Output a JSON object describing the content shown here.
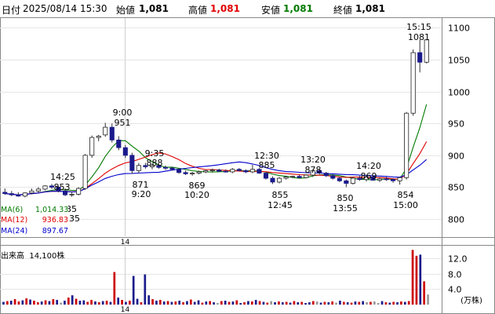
{
  "header": {
    "label_date": "日付",
    "datetime": "2025/08/14 15:30",
    "label_open": "始値",
    "open": "1,081",
    "label_high": "高値",
    "high": "1,081",
    "label_low": "安値",
    "low": "1,081",
    "label_close": "終値",
    "close": "1,081"
  },
  "ma_legend": [
    {
      "name": "MA(6)",
      "value": "1,014.33",
      "color": "#007a00"
    },
    {
      "name": "MA(12)",
      "value": "936.83",
      "color": "#e00000"
    },
    {
      "name": "MA(24)",
      "value": "897.67",
      "color": "#0000cc"
    }
  ],
  "volume_label": {
    "name": "出来高",
    "value": "14,100株"
  },
  "colors": {
    "up": "#cc0000",
    "down": "#1a1a8c",
    "flat": "#999999",
    "grid": "#e6e6e6"
  },
  "chart_data": [
    {
      "type": "candlestick",
      "title": "",
      "y_axis_side": "right",
      "y_ticks": [
        800,
        850,
        900,
        950,
        1000,
        1050,
        1100
      ],
      "ylim": [
        773,
        1114
      ],
      "x_tick_labels": [
        "14"
      ],
      "candles": [
        [
          842,
          848,
          838,
          840
        ],
        [
          840,
          844,
          836,
          838
        ],
        [
          838,
          842,
          835,
          836
        ],
        [
          836,
          842,
          834,
          841
        ],
        [
          841,
          848,
          839,
          844
        ],
        [
          844,
          850,
          841,
          847
        ],
        [
          847,
          853,
          845,
          852
        ],
        [
          852,
          855,
          847,
          850
        ],
        [
          850,
          852,
          842,
          844
        ],
        [
          844,
          848,
          836,
          838
        ],
        [
          838,
          843,
          835,
          839
        ],
        [
          839,
          850,
          837,
          848
        ],
        [
          848,
          902,
          846,
          900
        ],
        [
          900,
          931,
          896,
          928
        ],
        [
          928,
          932,
          922,
          930
        ],
        [
          932,
          951,
          929,
          944
        ],
        [
          944,
          950,
          920,
          924
        ],
        [
          924,
          930,
          908,
          912
        ],
        [
          912,
          916,
          896,
          900
        ],
        [
          900,
          904,
          871,
          876
        ],
        [
          876,
          888,
          872,
          884
        ],
        [
          884,
          888,
          879,
          882
        ],
        [
          882,
          886,
          878,
          884
        ],
        [
          884,
          886,
          879,
          881
        ],
        [
          881,
          884,
          877,
          880
        ],
        [
          880,
          882,
          876,
          878
        ],
        [
          878,
          880,
          871,
          873
        ],
        [
          873,
          876,
          869,
          871
        ],
        [
          871,
          874,
          868,
          872
        ],
        [
          872,
          876,
          870,
          874
        ],
        [
          874,
          878,
          872,
          876
        ],
        [
          876,
          879,
          873,
          877
        ],
        [
          877,
          879,
          874,
          875
        ],
        [
          875,
          878,
          873,
          874
        ],
        [
          874,
          880,
          872,
          878
        ],
        [
          878,
          880,
          875,
          876
        ],
        [
          876,
          878,
          872,
          874
        ],
        [
          874,
          885,
          872,
          878
        ],
        [
          878,
          880,
          871,
          872
        ],
        [
          872,
          874,
          862,
          864
        ],
        [
          864,
          867,
          855,
          858
        ],
        [
          858,
          866,
          856,
          864
        ],
        [
          864,
          868,
          862,
          866
        ],
        [
          866,
          868,
          864,
          867
        ],
        [
          867,
          869,
          864,
          865
        ],
        [
          865,
          870,
          864,
          869
        ],
        [
          869,
          878,
          866,
          876
        ],
        [
          876,
          878,
          870,
          872
        ],
        [
          872,
          874,
          866,
          868
        ],
        [
          868,
          870,
          862,
          864
        ],
        [
          864,
          866,
          858,
          860
        ],
        [
          860,
          862,
          850,
          856
        ],
        [
          856,
          866,
          854,
          864
        ],
        [
          864,
          868,
          860,
          862
        ],
        [
          862,
          869,
          859,
          866
        ],
        [
          866,
          868,
          860,
          861
        ],
        [
          861,
          865,
          858,
          863
        ],
        [
          863,
          866,
          860,
          862
        ],
        [
          862,
          864,
          857,
          860
        ],
        [
          860,
          866,
          854,
          865
        ],
        [
          865,
          968,
          862,
          966
        ],
        [
          966,
          1066,
          962,
          1061
        ],
        [
          1061,
          1081,
          1030,
          1046
        ],
        [
          1046,
          1081,
          1044,
          1081
        ]
      ],
      "labels": [
        {
          "text": "14:25",
          "value": 853
        },
        {
          "text": "853",
          "value": 853
        },
        {
          "text": "9:00",
          "value": 951
        },
        {
          "text": "951",
          "value": 951
        },
        {
          "text": "9:35",
          "value": 888
        },
        {
          "text": "888",
          "value": 888
        },
        {
          "text": "871",
          "value": 871
        },
        {
          "text": "9:20",
          "value": 871
        },
        {
          "text": "869",
          "value": 869
        },
        {
          "text": "10:20",
          "value": 869
        },
        {
          "text": "12:30",
          "value": 885
        },
        {
          "text": "885",
          "value": 885
        },
        {
          "text": "855",
          "value": 855
        },
        {
          "text": "12:45",
          "value": 855
        },
        {
          "text": "13:20",
          "value": 878
        },
        {
          "text": "878",
          "value": 878
        },
        {
          "text": "850",
          "value": 850
        },
        {
          "text": "13:55",
          "value": 850
        },
        {
          "text": "14:20",
          "value": 869
        },
        {
          "text": "869",
          "value": 869
        },
        {
          "text": "854",
          "value": 854
        },
        {
          "text": "15:00",
          "value": 854
        },
        {
          "text": "15:15",
          "value": 1081
        },
        {
          "text": "1081",
          "value": 1081
        },
        {
          "text": "35",
          "value": 835
        },
        {
          "text": "35",
          "value": 835
        }
      ]
    },
    {
      "type": "bar",
      "title": "出来高",
      "y_unit": "(万株)",
      "y_ticks": [
        4.0,
        8.0,
        12.0
      ],
      "ylim": [
        0,
        15
      ],
      "values": [
        0.7,
        0.9,
        1.0,
        1.4,
        0.8,
        1.1,
        1.6,
        1.3,
        1.0,
        0.6,
        0.8,
        1.1,
        0.9,
        1.4,
        1.2,
        0.5,
        1.0,
        1.8,
        2.4,
        1.5,
        1.0,
        1.1,
        0.7,
        1.2,
        0.8,
        0.6,
        0.9,
        1.0,
        0.7,
        8.4,
        1.8,
        1.2,
        0.7,
        1.0,
        7.4,
        1.5,
        0.6,
        7.8,
        2.4,
        1.4,
        1.0,
        1.2,
        0.8,
        0.9,
        0.7,
        0.8,
        1.0,
        0.6,
        0.9,
        1.3,
        0.7,
        1.1,
        0.5,
        0.8,
        0.9,
        0.6,
        0.4,
        0.9,
        1.0,
        0.7,
        0.8,
        1.1,
        0.4,
        0.6,
        0.9,
        0.8,
        1.2,
        0.9,
        0.7,
        0.5,
        0.9,
        0.6,
        0.8,
        0.6,
        0.7,
        0.5,
        0.9,
        0.6,
        0.7,
        0.4,
        0.6,
        0.9,
        0.8,
        0.5,
        0.7,
        0.6,
        0.8,
        0.5,
        1.0,
        0.7,
        0.6,
        0.5,
        0.8,
        0.7,
        0.9,
        0.6,
        0.7,
        0.8,
        0.4,
        0.9,
        0.6,
        0.5,
        0.7,
        0.6,
        0.8,
        0.7,
        0.9,
        14.1,
        12.6,
        12.9,
        6.0,
        2.6
      ],
      "directions": [
        "d",
        "u",
        "d",
        "u",
        "u",
        "d",
        "u",
        "d",
        "u",
        "u",
        "d",
        "u",
        "d",
        "u",
        "d",
        "f",
        "d",
        "u",
        "d",
        "u",
        "d",
        "d",
        "u",
        "u",
        "d",
        "u",
        "d",
        "u",
        "d",
        "u",
        "d",
        "u",
        "d",
        "u",
        "d",
        "d",
        "u",
        "d",
        "d",
        "u",
        "d",
        "u",
        "d",
        "u",
        "d",
        "u",
        "d",
        "u",
        "d",
        "u",
        "d",
        "d",
        "u",
        "d",
        "u",
        "d",
        "f",
        "u",
        "d",
        "u",
        "d",
        "u",
        "d",
        "u",
        "d",
        "u",
        "d",
        "u",
        "d",
        "u",
        "f",
        "d",
        "u",
        "d",
        "u",
        "d",
        "u",
        "d",
        "u",
        "d",
        "d",
        "u",
        "f",
        "d",
        "u",
        "d",
        "u",
        "f",
        "d",
        "u",
        "d",
        "u",
        "d",
        "u",
        "d",
        "f",
        "u",
        "f",
        "f",
        "d",
        "u",
        "d",
        "u",
        "d",
        "u",
        "d",
        "u",
        "u",
        "u",
        "d",
        "u",
        "f"
      ]
    }
  ]
}
